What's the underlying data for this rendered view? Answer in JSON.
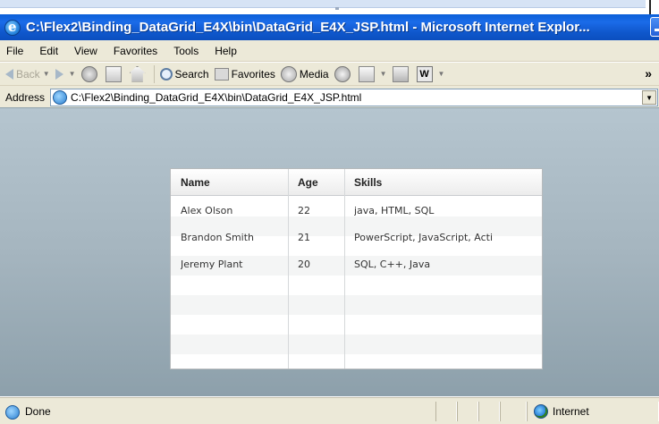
{
  "window": {
    "title": "C:\\Flex2\\Binding_DataGrid_E4X\\bin\\DataGrid_E4X_JSP.html - Microsoft Internet Explor..."
  },
  "menu": [
    "File",
    "Edit",
    "View",
    "Favorites",
    "Tools",
    "Help"
  ],
  "toolbar": {
    "back_label": "Back",
    "search_label": "Search",
    "favorites_label": "Favorites",
    "media_label": "Media",
    "more_glyph": "»"
  },
  "address": {
    "label": "Address",
    "url": "C:\\Flex2\\Binding_DataGrid_E4X\\bin\\DataGrid_E4X_JSP.html"
  },
  "datagrid": {
    "columns": [
      "Name",
      "Age",
      "Skills"
    ],
    "rows": [
      [
        "Alex Olson",
        "22",
        "java, HTML, SQL"
      ],
      [
        "Brandon Smith",
        "21",
        "PowerScript, JavaScript, Acti"
      ],
      [
        "Jeremy Plant",
        "20",
        "SQL, C++, Java"
      ]
    ]
  },
  "status": {
    "text": "Done",
    "zone": "Internet"
  },
  "colors": {
    "titlebar": "#0a5fd8",
    "chrome": "#ece9d8",
    "content_bg_top": "#b5c5cf",
    "content_bg_bottom": "#8da0ab"
  }
}
